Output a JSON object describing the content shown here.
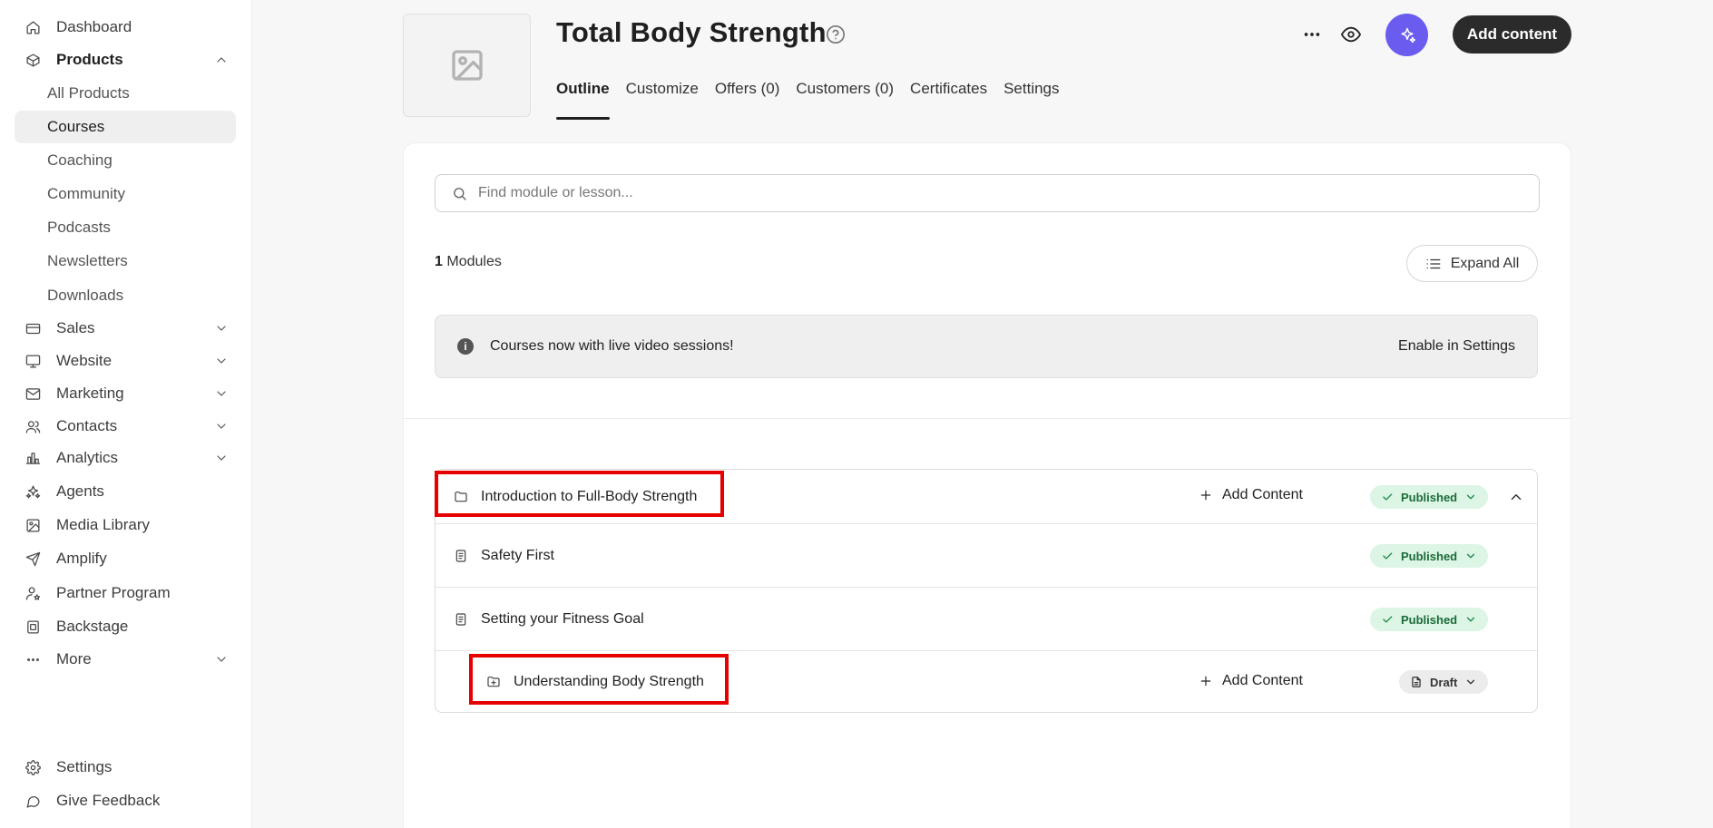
{
  "sidebar": {
    "items": [
      {
        "label": "Dashboard",
        "icon": "home-icon"
      },
      {
        "label": "Products",
        "icon": "box-icon"
      },
      {
        "label": "Sales",
        "icon": "credit-card-icon"
      },
      {
        "label": "Website",
        "icon": "monitor-icon"
      },
      {
        "label": "Marketing",
        "icon": "mail-icon"
      },
      {
        "label": "Contacts",
        "icon": "users-icon"
      },
      {
        "label": "Analytics",
        "icon": "bar-chart-icon"
      },
      {
        "label": "Agents",
        "icon": "sparkles-icon"
      },
      {
        "label": "Media Library",
        "icon": "image-icon"
      },
      {
        "label": "Amplify",
        "icon": "send-icon"
      },
      {
        "label": "Partner Program",
        "icon": "user-star-icon"
      },
      {
        "label": "Backstage",
        "icon": "square-icon"
      },
      {
        "label": "More",
        "icon": "dots-icon"
      },
      {
        "label": "Settings",
        "icon": "gear-icon"
      },
      {
        "label": "Give Feedback",
        "icon": "message-icon"
      }
    ],
    "products_sub": [
      "All Products",
      "Courses",
      "Coaching",
      "Community",
      "Podcasts",
      "Newsletters",
      "Downloads"
    ]
  },
  "header": {
    "title": "Total Body Strength",
    "tabs": [
      "Outline",
      "Customize",
      "Offers (0)",
      "Customers (0)",
      "Certificates",
      "Settings"
    ],
    "add_content_label": "Add content"
  },
  "main": {
    "search_placeholder": "Find module or lesson...",
    "modules_count": "1",
    "modules_label": "Modules",
    "expand_all_label": "Expand All",
    "banner_text": "Courses now with live video sessions!",
    "banner_link": "Enable in Settings"
  },
  "outline": {
    "rows": [
      {
        "label": "Introduction to Full-Body Strength",
        "type": "module",
        "add_label": "Add Content",
        "status": "Published"
      },
      {
        "label": "Safety First",
        "type": "lesson",
        "status": "Published"
      },
      {
        "label": "Setting your Fitness Goal",
        "type": "lesson",
        "status": "Published"
      },
      {
        "label": "Understanding Body Strength",
        "type": "submodule",
        "add_label": "Add Content",
        "status": "Draft"
      }
    ]
  },
  "colors": {
    "accent": "#6b5cf0",
    "primary_button": "#2b2b2b",
    "published_bg": "#dcf5e4",
    "published_text": "#1c6b3a",
    "highlight": "#e60000"
  }
}
